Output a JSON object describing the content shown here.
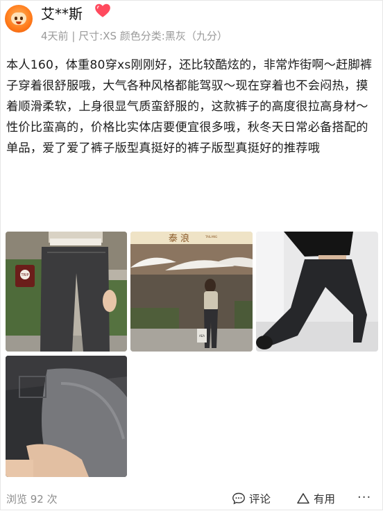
{
  "reviewer": {
    "name": "艾**斯",
    "badge_icon": "heart-icon",
    "avatar_icon": "cartoon-avatar"
  },
  "meta": {
    "time": "4天前",
    "separator": "|",
    "spec": "尺寸:XS 颜色分类:黑灰（九分）"
  },
  "review": {
    "text": "本人160，体重80穿xs刚刚好，还比较酷炫的，非常炸街啊～赶脚裤子穿着很舒服哦，大气各种风格都能驾驭～现在穿着也不会闷热，摸着顺滑柔软，上身很显气质蛮舒服的，这款裤子的高度很拉高身材～性价比蛮高的，价格比实体店要便宜很多哦，秋冬天日常必备搭配的单品，爱了爱了裤子版型真挺好的裤子版型真挺好的推荐哦"
  },
  "photos": {
    "photo2_sign": "泰  浪",
    "photo2_sign_small": "TAILANG",
    "photo2_bag_text": "AEA",
    "photo1_cup_text": "TRIP"
  },
  "footer": {
    "views": "浏览 92 次",
    "comment_label": "评论",
    "useful_label": "有用",
    "more_label": "···"
  },
  "colors": {
    "heart": "#ff4a5e",
    "meta_text": "#9a9a9a",
    "avatar": "#ff7a1a"
  }
}
